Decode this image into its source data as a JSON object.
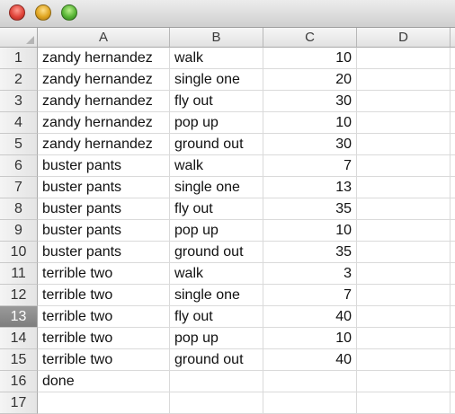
{
  "columns": [
    "A",
    "B",
    "C",
    "D"
  ],
  "rows": [
    {
      "n": "1",
      "a": "zandy hernandez",
      "b": "walk",
      "c": "10"
    },
    {
      "n": "2",
      "a": "zandy hernandez",
      "b": "single one",
      "c": "20"
    },
    {
      "n": "3",
      "a": "zandy hernandez",
      "b": "fly out",
      "c": "30"
    },
    {
      "n": "4",
      "a": "zandy hernandez",
      "b": "pop up",
      "c": "10"
    },
    {
      "n": "5",
      "a": "zandy hernandez",
      "b": "ground out",
      "c": "30"
    },
    {
      "n": "6",
      "a": "buster pants",
      "b": "walk",
      "c": "7"
    },
    {
      "n": "7",
      "a": "buster pants",
      "b": "single one",
      "c": "13"
    },
    {
      "n": "8",
      "a": "buster pants",
      "b": "fly out",
      "c": "35"
    },
    {
      "n": "9",
      "a": "buster pants",
      "b": "pop up",
      "c": "10"
    },
    {
      "n": "10",
      "a": "buster pants",
      "b": "ground out",
      "c": "35"
    },
    {
      "n": "11",
      "a": "terrible two",
      "b": "walk",
      "c": "3"
    },
    {
      "n": "12",
      "a": "terrible two",
      "b": "single one",
      "c": "7"
    },
    {
      "n": "13",
      "a": "terrible two",
      "b": "fly out",
      "c": "40"
    },
    {
      "n": "14",
      "a": "terrible two",
      "b": "pop up",
      "c": "10"
    },
    {
      "n": "15",
      "a": "terrible two",
      "b": "ground out",
      "c": "40"
    },
    {
      "n": "16",
      "a": "done",
      "b": "",
      "c": ""
    },
    {
      "n": "17",
      "a": "",
      "b": "",
      "c": ""
    }
  ],
  "selected_row": "13",
  "colors": {
    "selected_row_header": "#8a8a8a",
    "gridline": "#dadada"
  }
}
